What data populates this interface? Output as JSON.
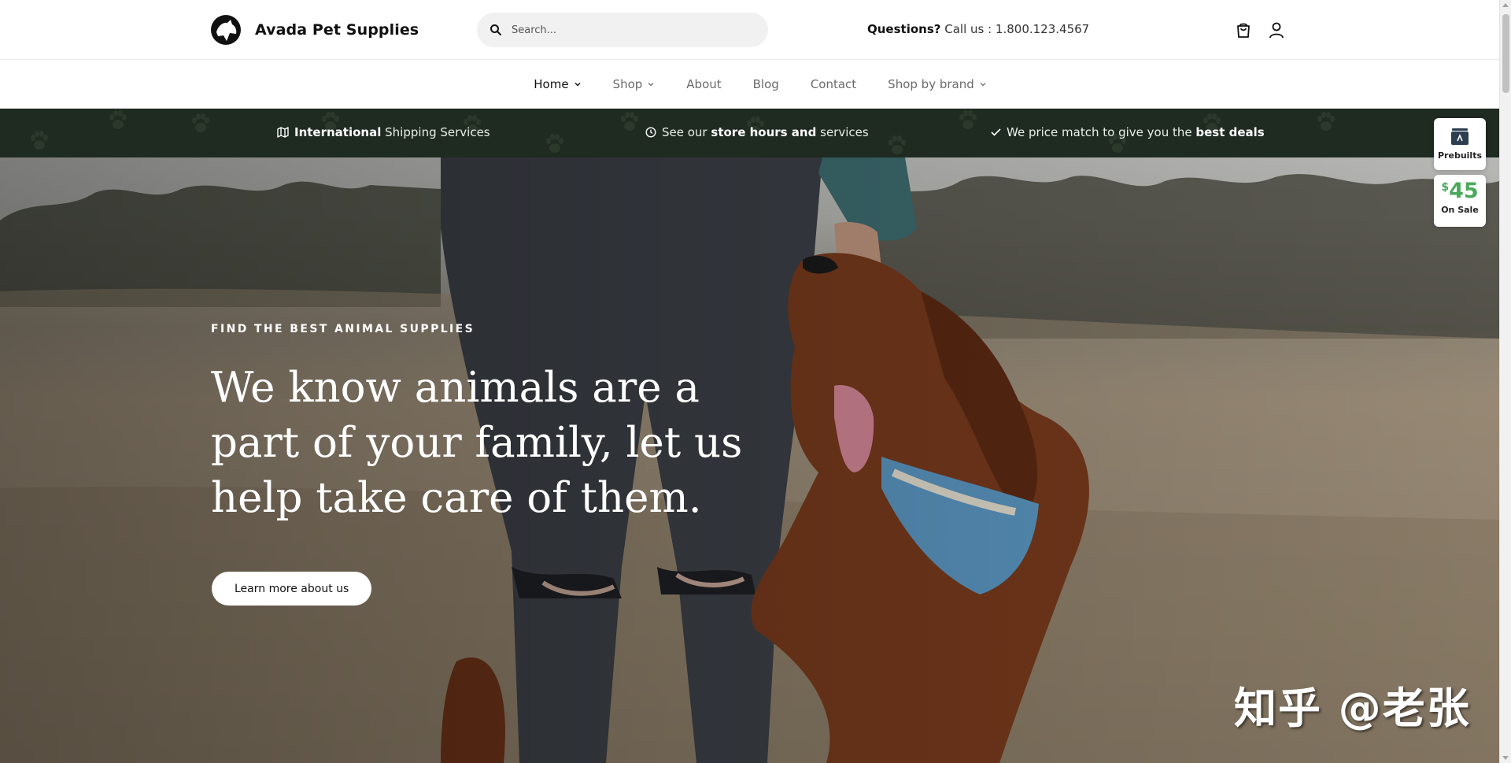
{
  "header": {
    "brand": "Avada Pet Supplies",
    "search_placeholder": "Search...",
    "questions_label": "Questions?",
    "questions_text": "Call us : 1.800.123.4567",
    "cart_icon": "shopping-bag-icon",
    "account_icon": "user-icon"
  },
  "nav": {
    "items": [
      {
        "label": "Home",
        "has_dropdown": true,
        "active": true
      },
      {
        "label": "Shop",
        "has_dropdown": true,
        "active": false
      },
      {
        "label": "About",
        "has_dropdown": false,
        "active": false
      },
      {
        "label": "Blog",
        "has_dropdown": false,
        "active": false
      },
      {
        "label": "Contact",
        "has_dropdown": false,
        "active": false
      },
      {
        "label": "Shop by brand",
        "has_dropdown": true,
        "active": false
      }
    ]
  },
  "promo": {
    "shipping_bold": "International",
    "shipping_rest": "Shipping Services",
    "hours_pre": "See our",
    "hours_bold": "store hours and",
    "hours_rest": "services",
    "price_pre": "We price match to give you the",
    "price_bold": "best deals",
    "background_color": "#1f2a20"
  },
  "hero": {
    "eyebrow": "FIND THE BEST ANIMAL SUPPLIES",
    "headline": "We know animals are a part of your family, let us help take care of them.",
    "cta_label": "Learn more about us"
  },
  "side_widgets": {
    "prebuilts_label": "Prebuilts",
    "sale_currency": "$",
    "sale_amount": "45",
    "sale_label": "On Sale",
    "sale_color": "#4aa95b"
  },
  "watermark": "知乎 @老张"
}
